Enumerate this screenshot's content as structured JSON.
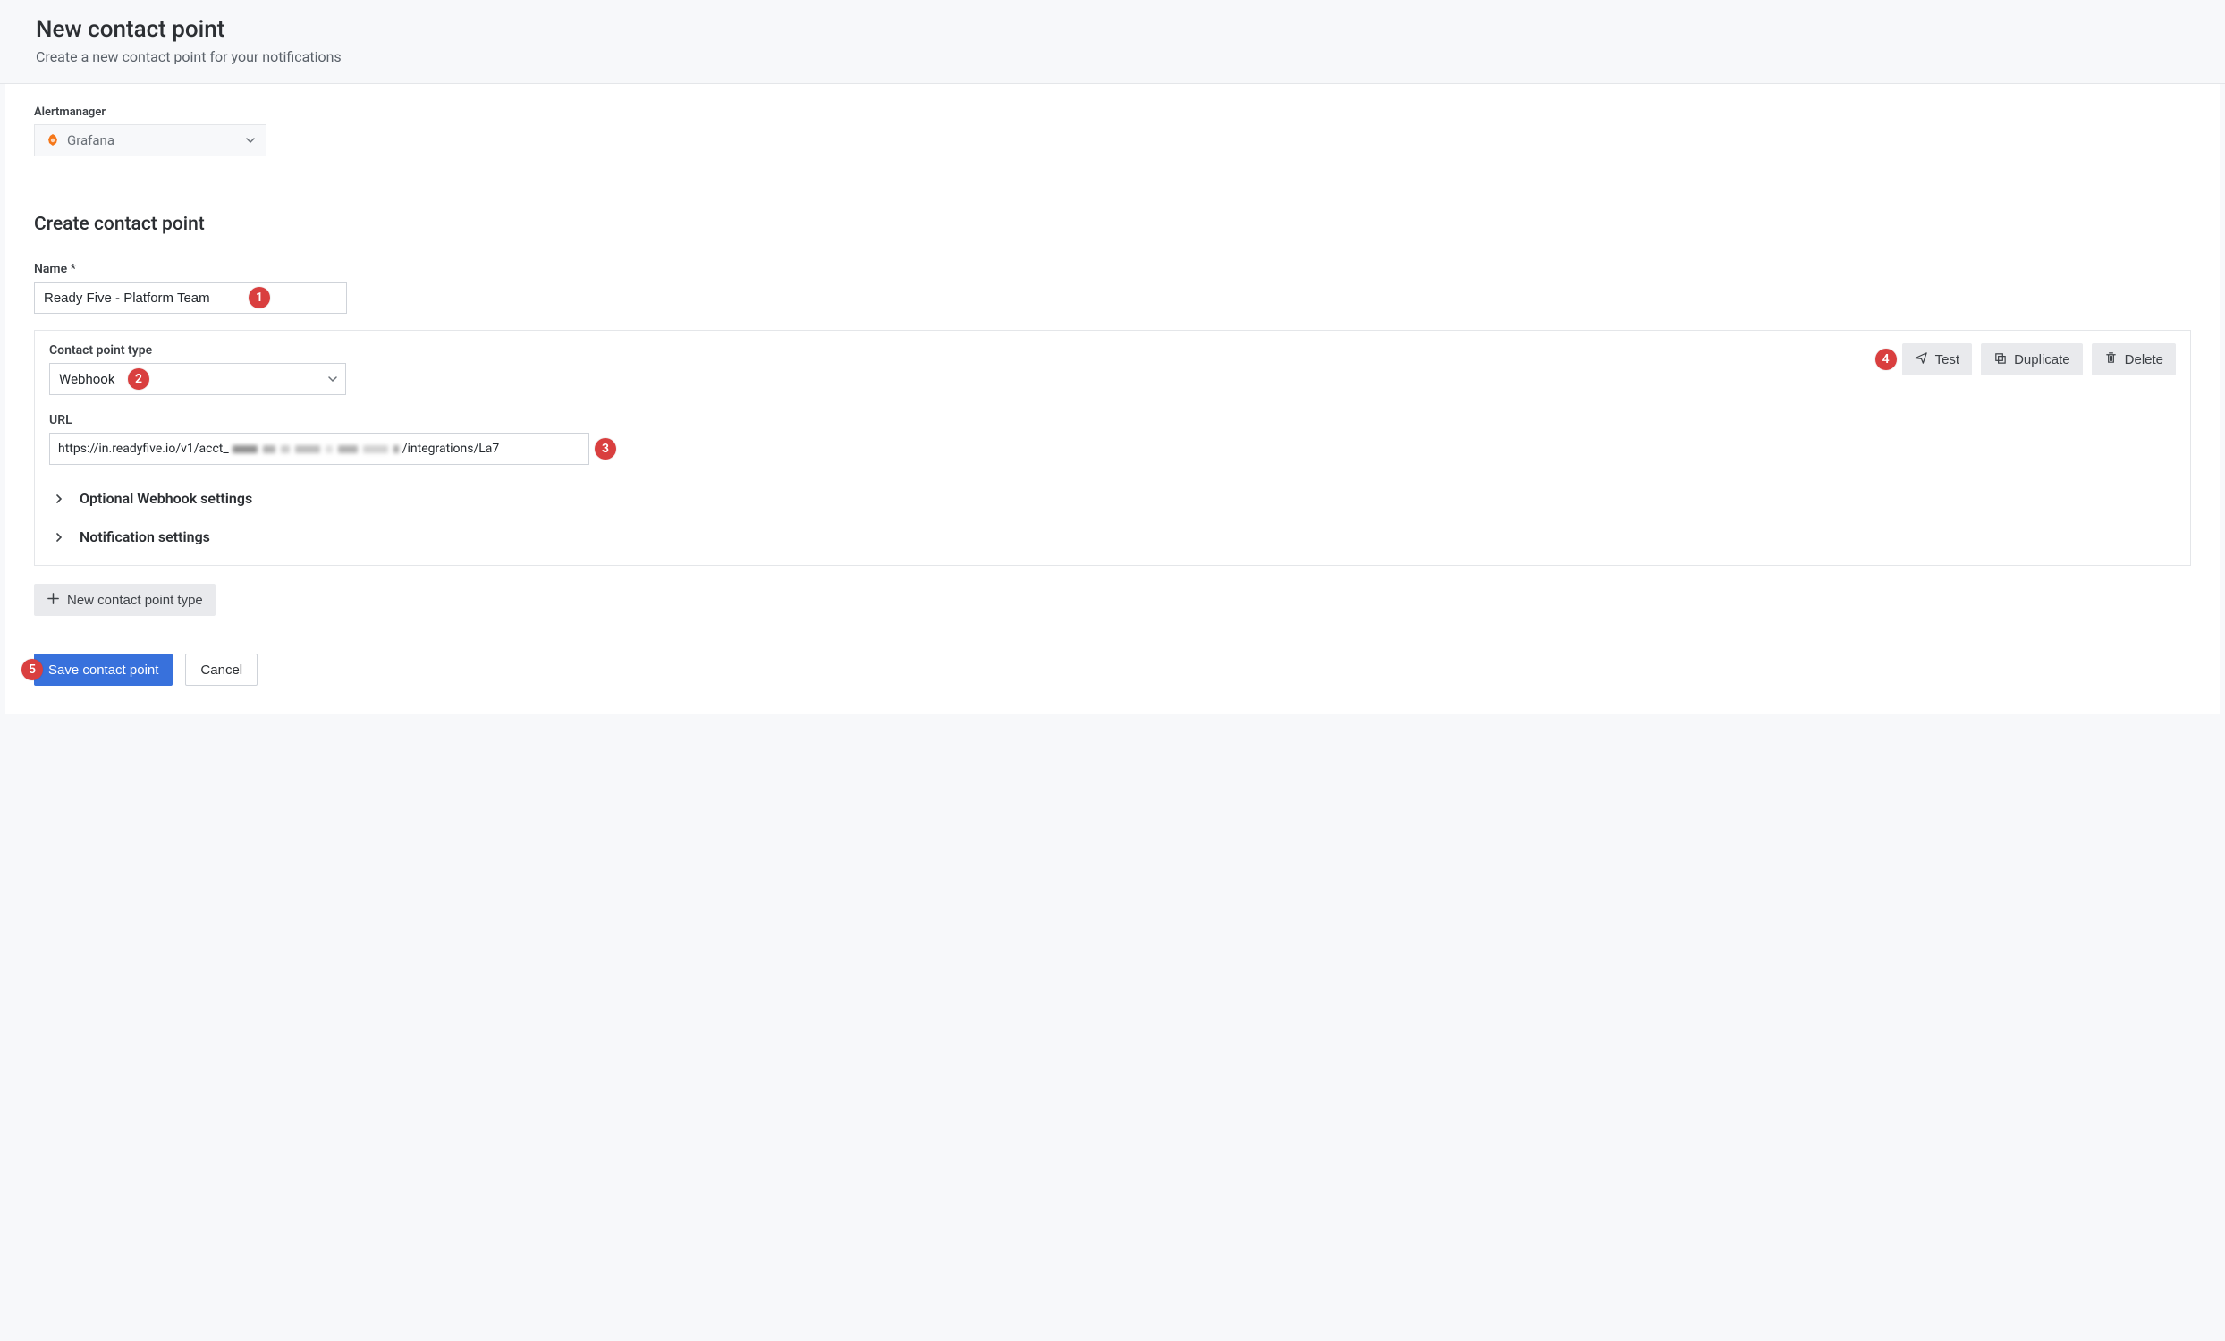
{
  "header": {
    "title": "New contact point",
    "subtitle": "Create a new contact point for your notifications"
  },
  "alertmanager": {
    "label": "Alertmanager",
    "selected": "Grafana"
  },
  "section": {
    "heading": "Create contact point"
  },
  "name": {
    "label": "Name *",
    "value": "Ready Five - Platform Team"
  },
  "type": {
    "label": "Contact point type",
    "value": "Webhook"
  },
  "url": {
    "label": "URL",
    "prefix": "https://in.readyfive.io/v1/acct_",
    "suffix": "/integrations/La7"
  },
  "collapse": {
    "webhook_settings": "Optional Webhook settings",
    "notification_settings": "Notification settings"
  },
  "action_buttons": {
    "test": "Test",
    "duplicate": "Duplicate",
    "delete": "Delete"
  },
  "new_type": "New contact point type",
  "footer": {
    "save": "Save contact point",
    "cancel": "Cancel"
  },
  "callouts": {
    "c1": "1",
    "c2": "2",
    "c3": "3",
    "c4": "4",
    "c5": "5"
  }
}
